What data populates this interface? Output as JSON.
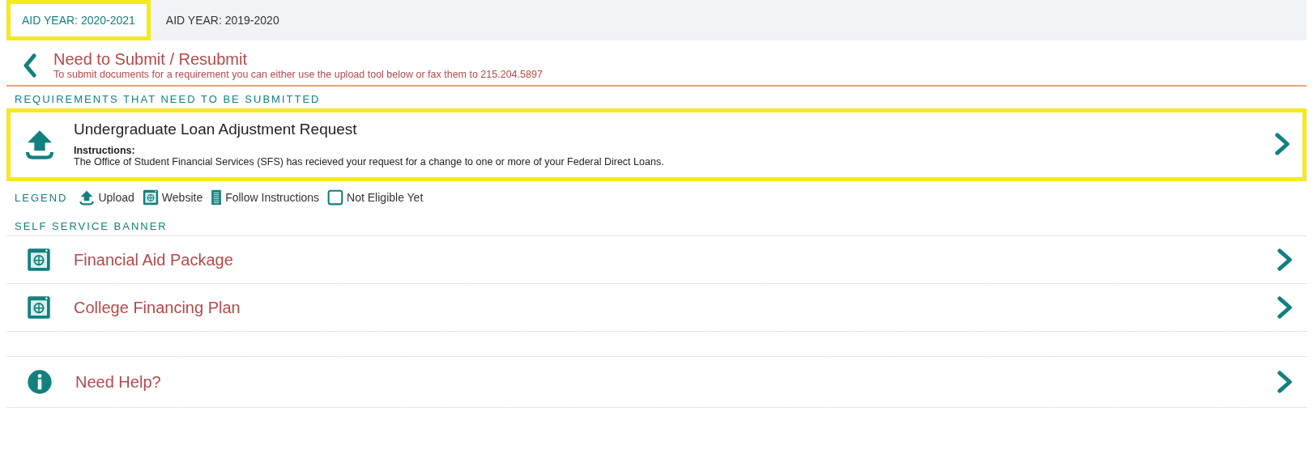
{
  "tabs": [
    {
      "label": "AID YEAR: 2020-2021",
      "selected": true,
      "highlighted": true
    },
    {
      "label": "AID YEAR: 2019-2020",
      "selected": false,
      "highlighted": false
    }
  ],
  "header": {
    "title": "Need to Submit / Resubmit",
    "subtitle": "To submit documents for a requirement you can either use the upload tool below or fax them to 215.204.5897"
  },
  "requirements": {
    "heading": "REQUIREMENTS THAT NEED TO BE SUBMITTED",
    "items": [
      {
        "kind": "upload",
        "title": "Undergraduate Loan Adjustment Request",
        "instructions_label": "Instructions:",
        "instructions": "The Office of Student Financial Services (SFS) has recieved your request for a change to one or more of your Federal Direct Loans.",
        "highlighted": true
      }
    ]
  },
  "legend": {
    "label": "LEGEND",
    "items": [
      {
        "kind": "upload",
        "label": "Upload"
      },
      {
        "kind": "website",
        "label": "Website"
      },
      {
        "kind": "instructions",
        "label": "Follow Instructions"
      },
      {
        "kind": "not-eligible",
        "label": "Not Eligible Yet"
      }
    ]
  },
  "self_service": {
    "heading": "SELF SERVICE BANNER",
    "links": [
      {
        "kind": "website",
        "label": "Financial Aid Package"
      },
      {
        "kind": "website",
        "label": "College Financing Plan"
      }
    ]
  },
  "help": {
    "kind": "info",
    "label": "Need Help?"
  }
}
